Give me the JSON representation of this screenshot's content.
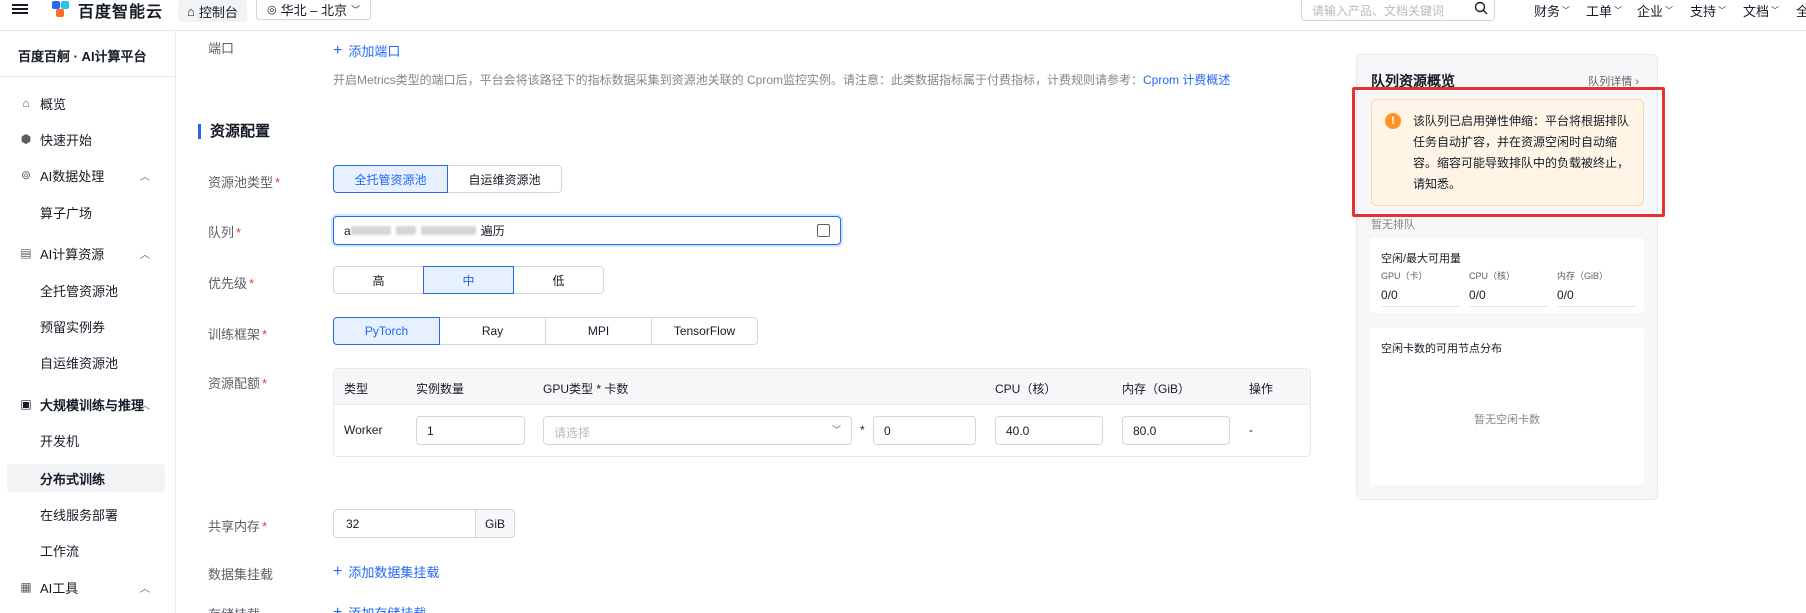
{
  "topbar": {
    "logo_text": "百度智能云",
    "console_label": "控制台",
    "region_label": "华北 – 北京",
    "search_placeholder": "请输入产品、文档关键词",
    "menus": [
      "财务",
      "工单",
      "企业",
      "支持",
      "文档",
      "全"
    ]
  },
  "sidebar": {
    "title": "百度百舸 · AI计算平台",
    "items": [
      {
        "label": "概览",
        "icon": "home-icon"
      },
      {
        "label": "快速开始",
        "icon": "rocket-icon"
      },
      {
        "label": "AI数据处理",
        "icon": "data-icon",
        "expanded": true
      },
      {
        "label": "算子广场"
      },
      {
        "label": "AI计算资源",
        "icon": "server-icon",
        "expanded": true
      },
      {
        "label": "全托管资源池"
      },
      {
        "label": "预留实例券"
      },
      {
        "label": "自运维资源池"
      },
      {
        "label": "大规模训练与推理",
        "icon": "terminal-icon",
        "expanded": true
      },
      {
        "label": "开发机"
      },
      {
        "label": "分布式训练"
      },
      {
        "label": "在线服务部署"
      },
      {
        "label": "工作流"
      },
      {
        "label": "AI工具",
        "icon": "grid-icon",
        "expanded": true
      }
    ]
  },
  "form": {
    "port_label": "端口",
    "add_port": "添加端口",
    "hint_text": "开启Metrics类型的端口后，平台会将该路径下的指标数据采集到资源池关联的 Cprom监控实例。请注意：此类数据指标属于付费指标，计费规则请参考：",
    "hint_link": "Cprom 计费概述",
    "section_title": "资源配置",
    "pool_type_label": "资源池类型",
    "pool_types": [
      "全托管资源池",
      "自运维资源池"
    ],
    "pool_type_selected": "全托管资源池",
    "queue_label": "队列",
    "queue_value_visible_prefix": "a",
    "queue_value_suffix": "遍历",
    "priority_label": "优先级",
    "priorities": [
      "高",
      "中",
      "低"
    ],
    "priority_selected": "中",
    "framework_label": "训练框架",
    "frameworks": [
      "PyTorch",
      "Ray",
      "MPI",
      "TensorFlow"
    ],
    "framework_selected": "PyTorch",
    "quota_label": "资源配额",
    "quota_table": {
      "headers": [
        "类型",
        "实例数量",
        "GPU类型 * 卡数",
        "CPU（核）",
        "内存（GiB）",
        "操作"
      ],
      "row": {
        "type": "Worker",
        "instances": "1",
        "gpu_placeholder": "请选择",
        "multiply": "*",
        "gpu_count": "0",
        "cpu": "40.0",
        "memory": "80.0",
        "action": "-"
      }
    },
    "shm_label": "共享内存",
    "shm_value": "32",
    "shm_unit": "GiB",
    "dataset_label": "数据集挂载",
    "add_dataset": "添加数据集挂载",
    "storage_label": "存储挂载",
    "add_storage": "添加存储挂载"
  },
  "panel": {
    "title": "队列资源概览",
    "detail_link": "队列详情",
    "alert_text": "该队列已启用弹性伸缩：平台将根据排队任务自动扩容，并在资源空闲时自动缩容。缩容可能导致排队中的负载被终止，请知悉。",
    "queue_status": "暂无排队",
    "capacity_title": "空闲/最大可用量",
    "stats": [
      {
        "key": "GPU（卡）",
        "value": "0/0"
      },
      {
        "key": "CPU（核）",
        "value": "0/0"
      },
      {
        "key": "内存（GiB）",
        "value": "0/0"
      }
    ],
    "nodes_title": "空闲卡数的可用节点分布",
    "nodes_empty": "暂无空闲卡数"
  }
}
